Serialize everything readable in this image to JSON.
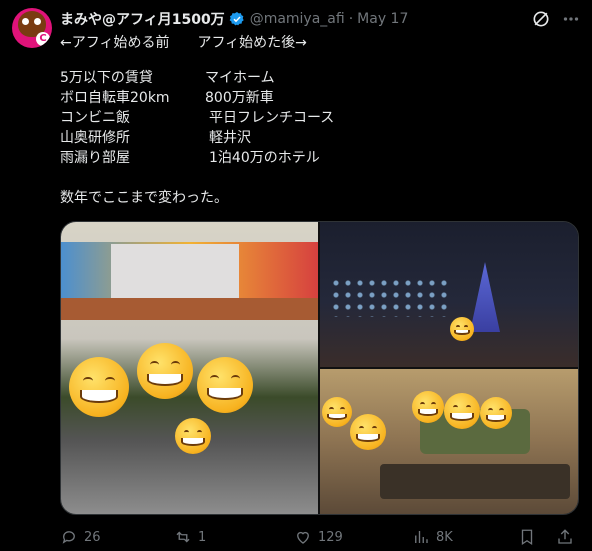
{
  "post": {
    "author_name": "まみや@アフィ月1500万",
    "handle": "@mamiya_afi",
    "separator": "·",
    "date": "May 17",
    "line1": "←アフィ始める前　　アフィ始めた後→",
    "rows": [
      {
        "before": "5万以下の賃貸",
        "after": "マイホーム"
      },
      {
        "before": "ボロ自転車20km",
        "after": "800万新車"
      },
      {
        "before": "コンビニ飯",
        "after": "平日フレンチコース"
      },
      {
        "before": "山奥研修所",
        "after": "軽井沢"
      },
      {
        "before": "雨漏り部屋",
        "after": "1泊40万のホテル"
      }
    ],
    "closing": "数年でここまで変わった。",
    "avatar_letter": "C"
  },
  "actions": {
    "replies": "26",
    "reposts": "1",
    "likes": "129",
    "views": "8K"
  },
  "icons": [
    "verified-badge-icon",
    "grok-icon",
    "more-icon",
    "reply-icon",
    "repost-icon",
    "like-icon",
    "views-icon",
    "bookmark-icon",
    "share-icon"
  ],
  "colors": {
    "background": "#000000",
    "text": "#e7e9ea",
    "muted": "#71767b",
    "verified": "#1d9bf0",
    "border": "#2f3336"
  }
}
